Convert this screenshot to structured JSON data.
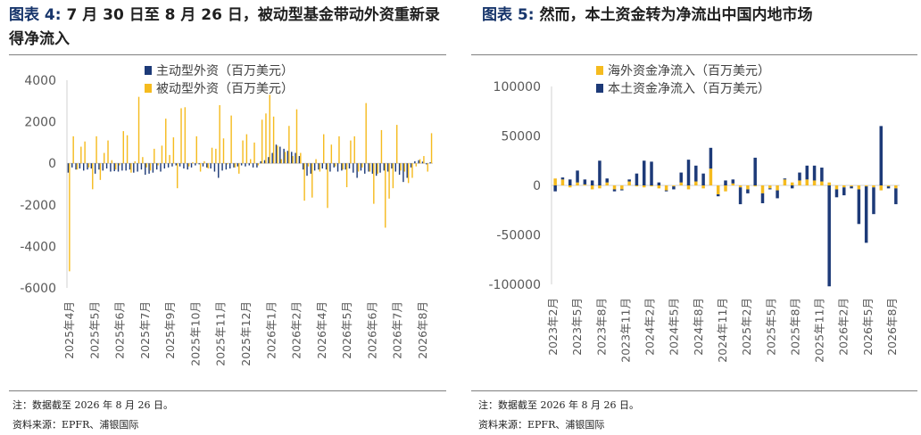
{
  "colors": {
    "active": "#1d3a78",
    "passive": "#f5bb1f",
    "domestic": "#1d3a78",
    "overseas": "#f5bb1f",
    "title_lead": "#17356b",
    "axis": "#d0d0d0",
    "rule": "#7f7f7f"
  },
  "left": {
    "title_lead": "图表 4:",
    "title_rest": "7 月 30 日至 8 月 26 日，被动型基金带动外资重新录得净流入",
    "note": "注：数据截至 2026 年 8 月 26 日。",
    "source": "资料来源：EPFR、浦银国际",
    "chart_data": {
      "type": "bar",
      "ylim": [
        -6000,
        4000
      ],
      "yticks": [
        4000,
        2000,
        0,
        -2000,
        -4000,
        -6000
      ],
      "legend_position": "top-center",
      "x_tick_labels": [
        "2025年4月",
        "2025年5月",
        "2025年6月",
        "2025年7月",
        "2025年9月",
        "2025年10月",
        "2025年11月",
        "2025年12月",
        "2026年1月",
        "2026年2月",
        "2026年4月",
        "2026年5月",
        "2026年6月",
        "2026年7月",
        "2026年8月"
      ],
      "series": [
        {
          "name": "主动型外资（百万美元）",
          "color_key": "active",
          "values": [
            -450,
            -200,
            -300,
            -250,
            -350,
            -300,
            -250,
            -500,
            -300,
            -350,
            -250,
            -400,
            -380,
            -400,
            -350,
            -350,
            -300,
            -450,
            -400,
            -300,
            -550,
            -500,
            -450,
            -300,
            -400,
            -250,
            -200,
            -150,
            -100,
            -150,
            -250,
            -300,
            -200,
            -100,
            -50,
            -150,
            -200,
            -250,
            -400,
            -700,
            -350,
            -300,
            -250,
            -200,
            -150,
            -100,
            -150,
            -100,
            -200,
            -200,
            100,
            150,
            300,
            500,
            900,
            800,
            700,
            600,
            550,
            500,
            350,
            -300,
            -600,
            -500,
            -350,
            -300,
            -250,
            -300,
            -400,
            -200,
            -400,
            -350,
            -300,
            -250,
            -450,
            -700,
            -350,
            -500,
            -400,
            -500,
            -600,
            -450,
            -350,
            -400,
            -250,
            -400,
            -550,
            -900,
            -700,
            -200,
            100,
            150,
            80,
            -50,
            50
          ]
        },
        {
          "name": "被动型外资（百万美元）",
          "color_key": "passive",
          "values": [
            -5200,
            1300,
            -300,
            800,
            1050,
            -200,
            -1250,
            1300,
            -800,
            500,
            1100,
            150,
            -300,
            -100,
            1550,
            1350,
            -450,
            100,
            3200,
            300,
            -200,
            -350,
            700,
            -100,
            850,
            2150,
            400,
            1250,
            -1200,
            2650,
            2700,
            -150,
            50,
            1300,
            -400,
            100,
            -250,
            750,
            700,
            2800,
            1200,
            -50,
            2300,
            -200,
            -500,
            1100,
            1400,
            200,
            1000,
            -100,
            2100,
            2400,
            3300,
            2250,
            850,
            200,
            550,
            1800,
            350,
            2600,
            500,
            -1800,
            -150,
            -1650,
            200,
            -400,
            1400,
            -2150,
            900,
            -150,
            1300,
            -300,
            -1150,
            1100,
            1300,
            -400,
            -200,
            2900,
            -400,
            -1950,
            -500,
            1600,
            -3100,
            -1700,
            -1200,
            1850,
            -350,
            -400,
            -950,
            -700,
            -150,
            200,
            350,
            -400,
            1450
          ]
        }
      ]
    }
  },
  "right": {
    "title_lead": "图表 5:",
    "title_rest": "然而，本土资金转为净流出中国内地市场",
    "note": "注：数据截至 2026 年 8 月 26 日。",
    "source": "资料来源：EPFR、浦银国际",
    "chart_data": {
      "type": "bar",
      "stacked": true,
      "ylim": [
        -100000,
        100000
      ],
      "yticks": [
        100000,
        50000,
        0,
        -50000,
        -100000
      ],
      "legend_position": "top-center",
      "x_tick_labels": [
        "2023年2月",
        "2023年5月",
        "2023年8月",
        "2023年11月",
        "2024年2月",
        "2024年5月",
        "2024年8月",
        "2024年11月",
        "2025年2月",
        "2025年5月",
        "2025年8月",
        "2025年11月",
        "2026年2月",
        "2026年5月",
        "2026年8月"
      ],
      "series": [
        {
          "name": "海外资金净流入（百万美元）",
          "color_key": "overseas",
          "values": [
            7000,
            6000,
            -2000,
            3000,
            1000,
            -4000,
            -3000,
            3000,
            -4000,
            -4000,
            4000,
            -1000,
            -2000,
            -1000,
            -3000,
            -5000,
            -1000,
            3000,
            -4000,
            4000,
            -3000,
            17000,
            -9000,
            -6000,
            2000,
            -2000,
            -4000,
            -1000,
            -8000,
            -3000,
            -5000,
            6000,
            3000,
            5000,
            6000,
            5000,
            4000,
            3000,
            -4000,
            -2000,
            -1000,
            -4000,
            -1000,
            -2000,
            -5000,
            -1000,
            -3000
          ]
        },
        {
          "name": "本土资金净流入（百万美元）",
          "color_key": "domestic",
          "values": [
            -6000,
            2000,
            6000,
            12000,
            5000,
            5000,
            25000,
            4000,
            -2000,
            -1000,
            2000,
            12000,
            25000,
            24000,
            3000,
            -1000,
            -3000,
            10000,
            26000,
            16000,
            12000,
            21000,
            -2000,
            5000,
            4000,
            -17000,
            -4000,
            28000,
            -10000,
            -1000,
            -8000,
            1000,
            -3000,
            8000,
            14000,
            15000,
            14000,
            -102000,
            -8000,
            -8000,
            -2000,
            -35000,
            -57000,
            -27000,
            60000,
            -2000,
            -16000
          ]
        }
      ]
    }
  }
}
